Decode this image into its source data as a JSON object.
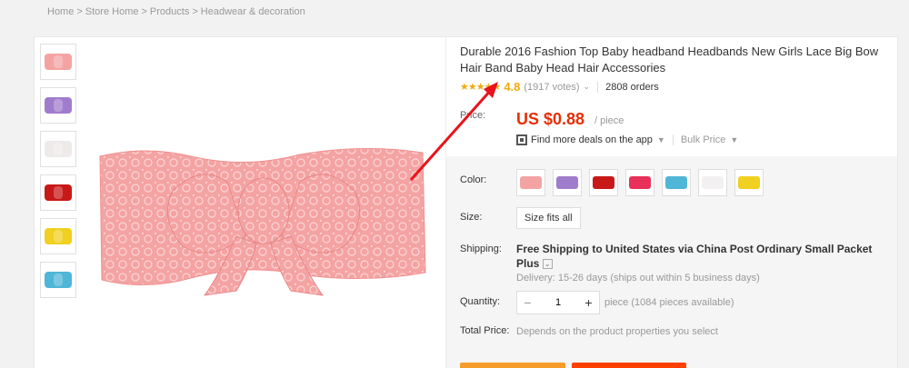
{
  "breadcrumb": [
    "Home",
    "Store Home",
    "Products",
    "Headwear & decoration"
  ],
  "breadcrumb_sep": ">",
  "thumbnails": [
    {
      "color_name": "pink",
      "color": "#f4a3a3"
    },
    {
      "color_name": "purple",
      "color": "#a07ccc"
    },
    {
      "color_name": "white",
      "color": "#eeeaea"
    },
    {
      "color_name": "red",
      "color": "#c81818"
    },
    {
      "color_name": "yellow",
      "color": "#f0d020"
    },
    {
      "color_name": "blue",
      "color": "#4fb6d8"
    }
  ],
  "product": {
    "title": "Durable 2016 Fashion Top Baby headband Headbands New Girls Lace Big Bow Hair Band Baby Head Hair Accessories",
    "stars": "★★★★★",
    "rating": "4.8",
    "votes": "(1917 votes)",
    "orders": "2808 orders",
    "price_label": "Price:",
    "price": "US $0.88",
    "per_unit": "/ piece",
    "app_deals": "Find more deals on the app",
    "bulk_price": "Bulk Price"
  },
  "options": {
    "color_label": "Color:",
    "colors": [
      "#f4a3a3",
      "#a07ccc",
      "#c81818",
      "#e8305a",
      "#4fb6d8",
      "#f2f0f0",
      "#f0d020"
    ],
    "size_label": "Size:",
    "size_value": "Size fits all",
    "shipping_label": "Shipping:",
    "shipping_text": "Free Shipping to United States via China Post Ordinary Small Packet Plus",
    "delivery": "Delivery: 15-26 days (ships out within 5 business days)",
    "quantity_label": "Quantity:",
    "quantity_value": "1",
    "quantity_minus": "−",
    "quantity_plus": "+",
    "pieces_available": "piece (1084 pieces available)",
    "total_label": "Total Price:",
    "total_note": "Depends on the product properties you select"
  },
  "colors": {
    "price": "#e62e04",
    "rating": "#f1ab0b",
    "arrow": "#e8131b",
    "lace": "#f4a3a3"
  }
}
